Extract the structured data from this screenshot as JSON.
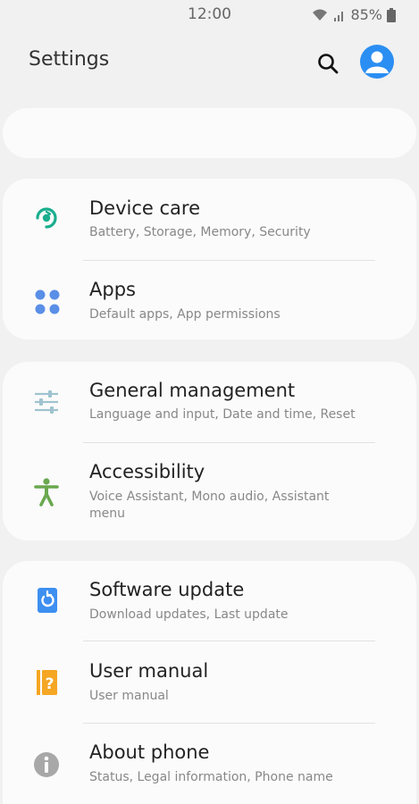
{
  "status": {
    "time": "12:00",
    "battery_percent": "85%",
    "icons": [
      "wifi-icon",
      "signal-icon",
      "battery-icon"
    ]
  },
  "header": {
    "title": "Settings",
    "search_icon": "search-icon",
    "account_icon": "profile-icon"
  },
  "search": {
    "placeholder": ""
  },
  "groups": [
    {
      "items": [
        {
          "title": "Device care",
          "subtitle": "Battery, Storage, Memory, Security",
          "icon": "device-care-icon",
          "icon_color": "#1aae8e"
        },
        {
          "title": "Apps",
          "subtitle": "Default apps, App permissions",
          "icon": "apps-icon",
          "icon_color": "#5a8fe8"
        }
      ]
    },
    {
      "items": [
        {
          "title": "General management",
          "subtitle": "Language and input, Date and time, Reset",
          "icon": "sliders-icon",
          "icon_color": "#9fc3cf"
        },
        {
          "title": "Accessibility",
          "subtitle": "Voice Assistant, Mono audio, Assistant menu",
          "icon": "accessibility-icon",
          "icon_color": "#6aa84f"
        }
      ]
    },
    {
      "items": [
        {
          "title": "Software update",
          "subtitle": "Download updates, Last update",
          "icon": "software-update-icon",
          "icon_color": "#3d8ff0"
        },
        {
          "title": "User manual",
          "subtitle": "User manual",
          "icon": "user-manual-icon",
          "icon_color": "#f5a623"
        },
        {
          "title": "About phone",
          "subtitle": "Status, Legal information, Phone name",
          "icon": "info-icon",
          "icon_color": "#a8a8a8"
        }
      ]
    }
  ],
  "colors": {
    "background": "#f1f1f1",
    "card": "#fbfbfb",
    "accent": "#2b8ef2"
  }
}
